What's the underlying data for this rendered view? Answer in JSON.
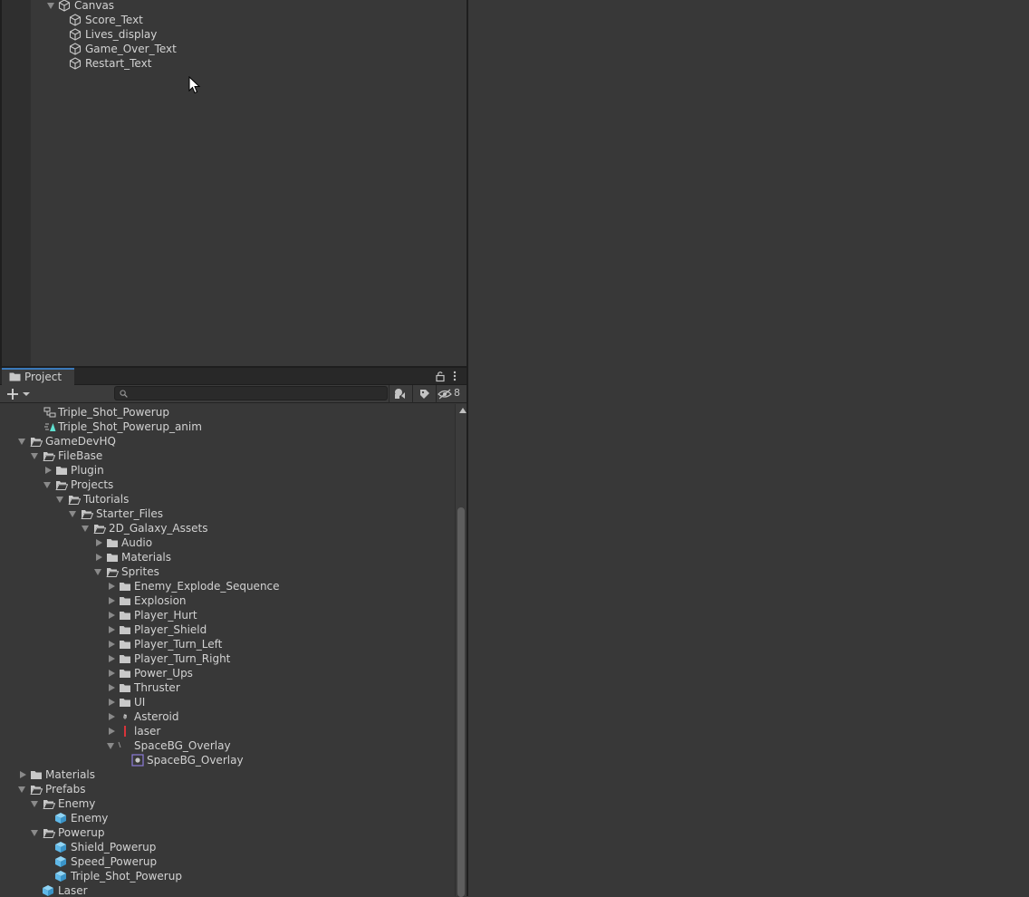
{
  "hierarchy": {
    "items": [
      {
        "label": "Canvas",
        "expanded": true
      },
      {
        "label": "Score_Text"
      },
      {
        "label": "Lives_display"
      },
      {
        "label": "Game_Over_Text"
      },
      {
        "label": "Restart_Text"
      }
    ]
  },
  "project": {
    "tab_label": "Project",
    "search": {
      "value": "",
      "placeholder": ""
    },
    "hidden_count": "8",
    "tree": [
      {
        "label": "Triple_Shot_Powerup",
        "icon": "animator-controller-icon"
      },
      {
        "label": "Triple_Shot_Powerup_anim",
        "icon": "animation-clip-icon"
      },
      {
        "label": "GameDevHQ",
        "icon": "folder-open-icon"
      },
      {
        "label": "FileBase",
        "icon": "folder-open-icon"
      },
      {
        "label": "Plugin",
        "icon": "folder-icon"
      },
      {
        "label": "Projects",
        "icon": "folder-open-icon"
      },
      {
        "label": "Tutorials",
        "icon": "folder-open-icon"
      },
      {
        "label": "Starter_Files",
        "icon": "folder-open-icon"
      },
      {
        "label": "2D_Galaxy_Assets",
        "icon": "folder-open-icon"
      },
      {
        "label": "Audio",
        "icon": "folder-icon"
      },
      {
        "label": "Materials",
        "icon": "folder-icon"
      },
      {
        "label": "Sprites",
        "icon": "folder-open-icon"
      },
      {
        "label": "Enemy_Explode_Sequence",
        "icon": "folder-icon"
      },
      {
        "label": "Explosion",
        "icon": "folder-icon"
      },
      {
        "label": "Player_Hurt",
        "icon": "folder-icon"
      },
      {
        "label": "Player_Shield",
        "icon": "folder-icon"
      },
      {
        "label": "Player_Turn_Left",
        "icon": "folder-icon"
      },
      {
        "label": "Player_Turn_Right",
        "icon": "folder-icon"
      },
      {
        "label": "Power_Ups",
        "icon": "folder-icon"
      },
      {
        "label": "Thruster",
        "icon": "folder-icon"
      },
      {
        "label": "UI",
        "icon": "folder-icon"
      },
      {
        "label": "Asteroid",
        "icon": "asteroid-sprite-icon"
      },
      {
        "label": "laser",
        "icon": "laser-sprite-icon"
      },
      {
        "label": "SpaceBG_Overlay",
        "icon": "sprite-texture-icon"
      },
      {
        "label": "SpaceBG_Overlay",
        "icon": "sprite-icon"
      },
      {
        "label": "Materials",
        "icon": "folder-icon"
      },
      {
        "label": "Prefabs",
        "icon": "folder-open-icon"
      },
      {
        "label": "Enemy",
        "icon": "folder-open-icon"
      },
      {
        "label": "Enemy",
        "icon": "prefab-icon"
      },
      {
        "label": "Powerup",
        "icon": "folder-open-icon"
      },
      {
        "label": "Shield_Powerup",
        "icon": "prefab-icon"
      },
      {
        "label": "Speed_Powerup",
        "icon": "prefab-icon"
      },
      {
        "label": "Triple_Shot_Powerup",
        "icon": "prefab-icon"
      },
      {
        "label": "Laser",
        "icon": "prefab-icon"
      }
    ]
  },
  "colors": {
    "panel_bg": "#383838",
    "accent_tab": "#3a79bb",
    "prefab_blue": "#5fb8e8",
    "laser_red": "#d8343a",
    "sprite_purple": "#8b7cd8"
  }
}
